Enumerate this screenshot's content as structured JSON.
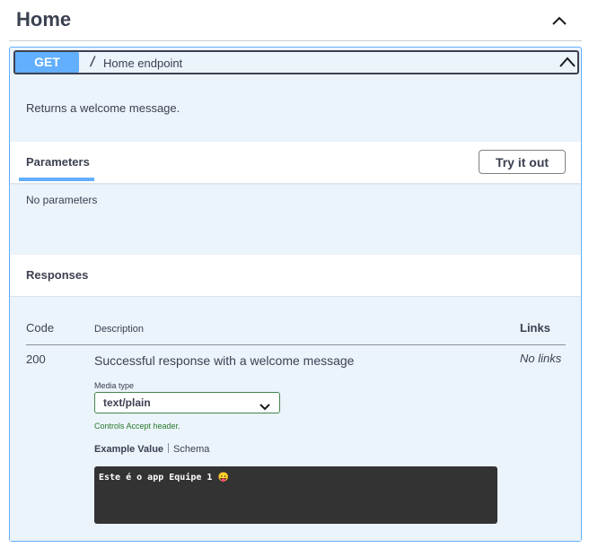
{
  "tag": {
    "title": "Home",
    "toggle_icon": "chevron-up-icon"
  },
  "operation": {
    "method": "GET",
    "path": "/",
    "summary": "Home endpoint",
    "description": "Returns a welcome message.",
    "collapse_icon": "chevron-up-icon",
    "colors": {
      "method_bg": "#61affe",
      "block_bg": "#ebf3fb",
      "border": "#61affe"
    }
  },
  "parameters": {
    "tab_label": "Parameters",
    "try_button": "Try it out",
    "empty_text": "No parameters"
  },
  "responses": {
    "header": "Responses",
    "columns": {
      "code": "Code",
      "description": "Description",
      "links": "Links"
    },
    "rows": [
      {
        "code": "200",
        "description": "Successful response with a welcome message",
        "links": "No links",
        "media_type_label": "Media type",
        "media_type_value": "text/plain",
        "controls_note": "Controls Accept header.",
        "example_tab": "Example Value",
        "schema_tab": "Schema",
        "example_body": "Este é o app Equipe 1 😛"
      }
    ]
  }
}
